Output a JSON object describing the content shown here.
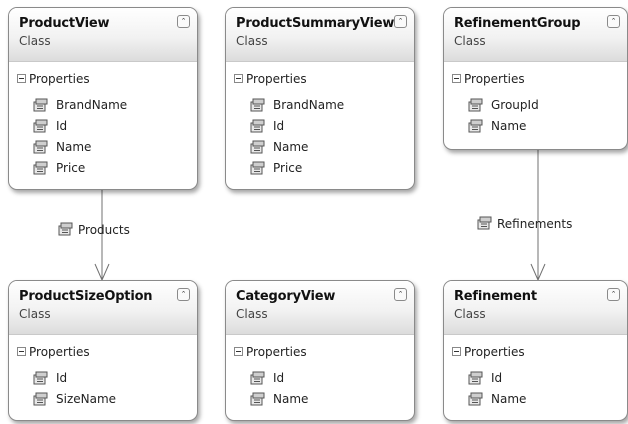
{
  "classes": [
    {
      "name": "ProductView",
      "kind": "Class",
      "section": "Properties",
      "properties": [
        "BrandName",
        "Id",
        "Name",
        "Price"
      ]
    },
    {
      "name": "ProductSummaryView",
      "kind": "Class",
      "section": "Properties",
      "properties": [
        "BrandName",
        "Id",
        "Name",
        "Price"
      ]
    },
    {
      "name": "RefinementGroup",
      "kind": "Class",
      "section": "Properties",
      "properties": [
        "GroupId",
        "Name"
      ]
    },
    {
      "name": "ProductSizeOption",
      "kind": "Class",
      "section": "Properties",
      "properties": [
        "Id",
        "SizeName"
      ]
    },
    {
      "name": "CategoryView",
      "kind": "Class",
      "section": "Properties",
      "properties": [
        "Id",
        "Name"
      ]
    },
    {
      "name": "Refinement",
      "kind": "Class",
      "section": "Properties",
      "properties": [
        "Id",
        "Name"
      ]
    }
  ],
  "associations": [
    {
      "label": "Products",
      "from": "ProductView",
      "to": "ProductSizeOption"
    },
    {
      "label": "Refinements",
      "from": "RefinementGroup",
      "to": "Refinement"
    }
  ],
  "icons": {
    "property": "property-icon",
    "collapse": "collapse-chevron-icon",
    "section": "minus-toggle-icon"
  }
}
